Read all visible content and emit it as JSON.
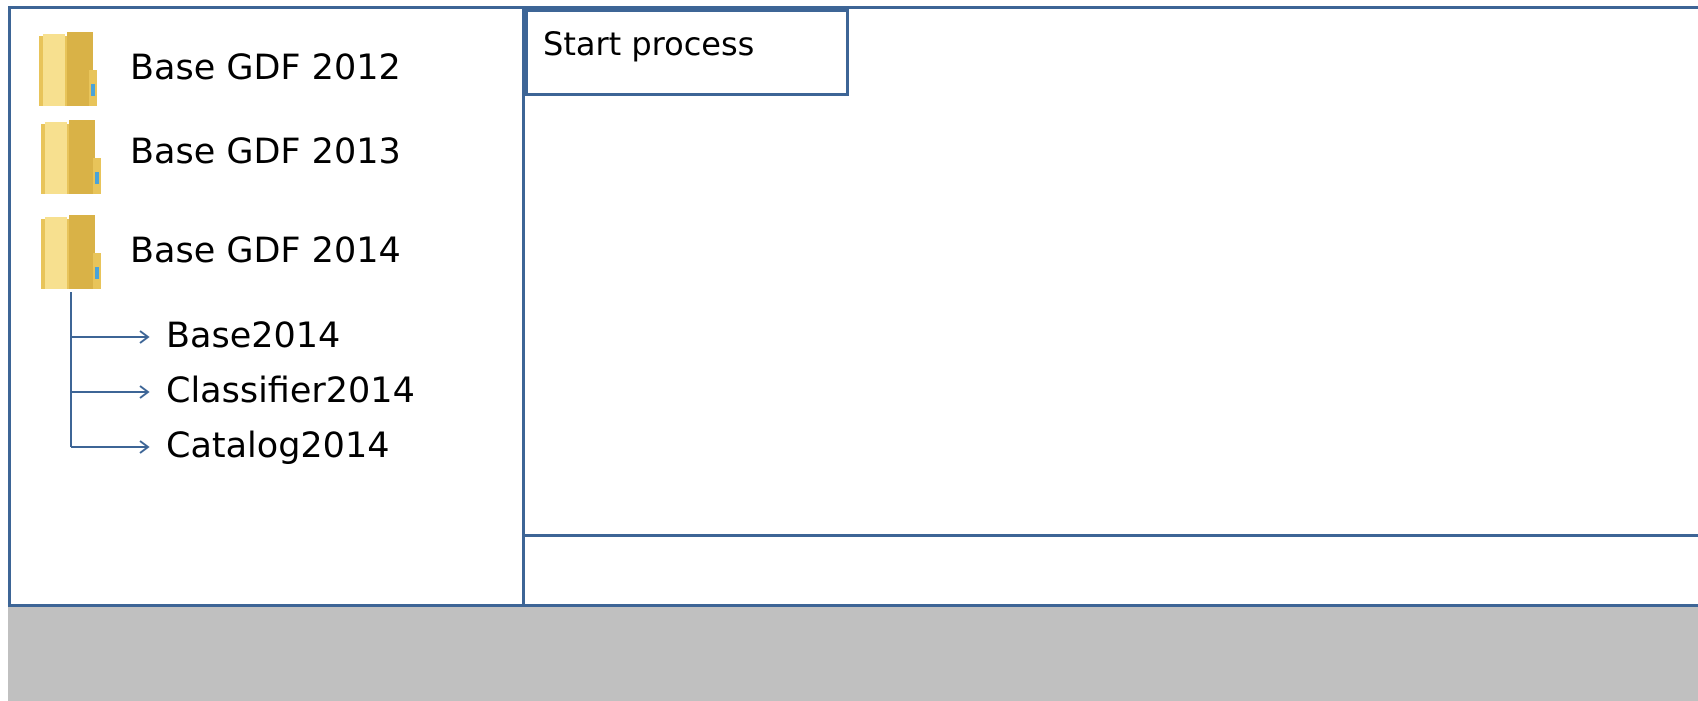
{
  "sidebar": {
    "folders": [
      {
        "label": "Base GDF 2012",
        "icon": "folder-icon"
      },
      {
        "label": "Base GDF 2013",
        "icon": "folder-icon"
      },
      {
        "label": "Base GDF 2014",
        "icon": "folder-icon"
      }
    ],
    "children": [
      {
        "label": "Base2014"
      },
      {
        "label": "Classifier2014"
      },
      {
        "label": "Catalog2014"
      }
    ]
  },
  "toolbar": {
    "start_label": "Start process"
  },
  "colors": {
    "border": "#3d6596",
    "status_bar": "#c0c0c0",
    "folder_yellow": "#f2d36b"
  }
}
